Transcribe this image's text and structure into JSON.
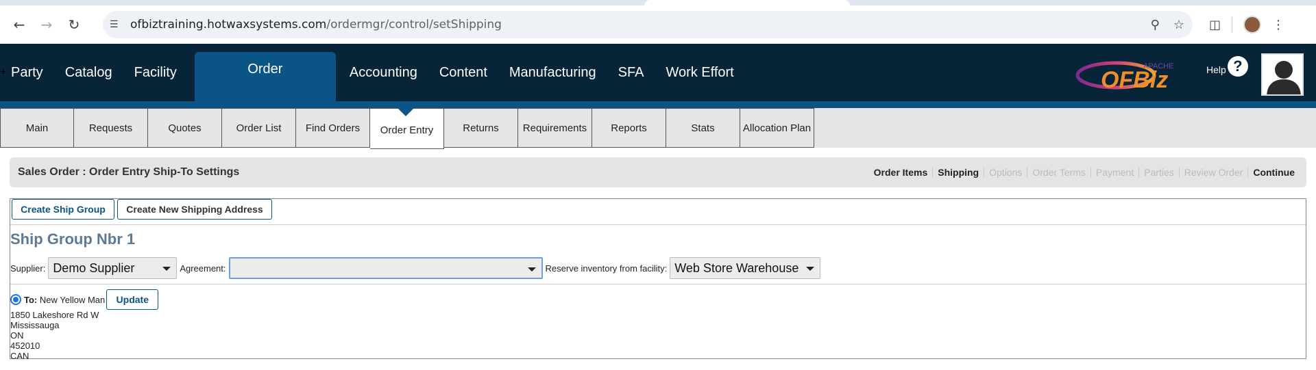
{
  "browser": {
    "url_host": "ofbiztraining.hotwaxsystems.com",
    "url_path": "/ordermgr/control/setShipping"
  },
  "main_nav": {
    "items": [
      "Party",
      "Catalog",
      "Facility",
      "Order",
      "Accounting",
      "Content",
      "Manufacturing",
      "SFA",
      "Work Effort"
    ],
    "plus": "+",
    "help": "Help",
    "logo_apache": "APACHE",
    "logo_text": "OFBiz"
  },
  "sub_nav": {
    "tabs": [
      "Main",
      "Requests",
      "Quotes",
      "Order List",
      "Find Orders",
      "Order Entry",
      "Returns",
      "Requirements",
      "Reports",
      "Stats",
      "Allocation Plan"
    ]
  },
  "page": {
    "title": "Sales Order : Order Entry Ship-To Settings",
    "steps": [
      {
        "label": "Order Items",
        "enabled": true
      },
      {
        "label": "Shipping",
        "enabled": true
      },
      {
        "label": "Options",
        "enabled": false
      },
      {
        "label": "Order Terms",
        "enabled": false
      },
      {
        "label": "Payment",
        "enabled": false
      },
      {
        "label": "Parties",
        "enabled": false
      },
      {
        "label": "Review Order",
        "enabled": false
      },
      {
        "label": "Continue",
        "enabled": true
      }
    ]
  },
  "shipping": {
    "create_group_label": "Create Ship Group",
    "create_address_label": "Create New Shipping Address",
    "group_heading": "Ship Group Nbr 1",
    "supplier_label": "Supplier:",
    "supplier_value": "Demo Supplier",
    "agreement_label": "Agreement:",
    "agreement_value": "",
    "facility_label": "Reserve inventory from facility:",
    "facility_value": "Web Store Warehouse",
    "address": {
      "to_label": "To:",
      "name": "New Yellow Man",
      "update_label": "Update",
      "street": "1850 Lakeshore Rd W",
      "city": "Mississauga",
      "state": "ON",
      "postal": "452010",
      "country": "CAN"
    }
  },
  "colors": {
    "header_bg": "#072438",
    "accent": "#0a5486",
    "heading": "#5c7a95"
  }
}
